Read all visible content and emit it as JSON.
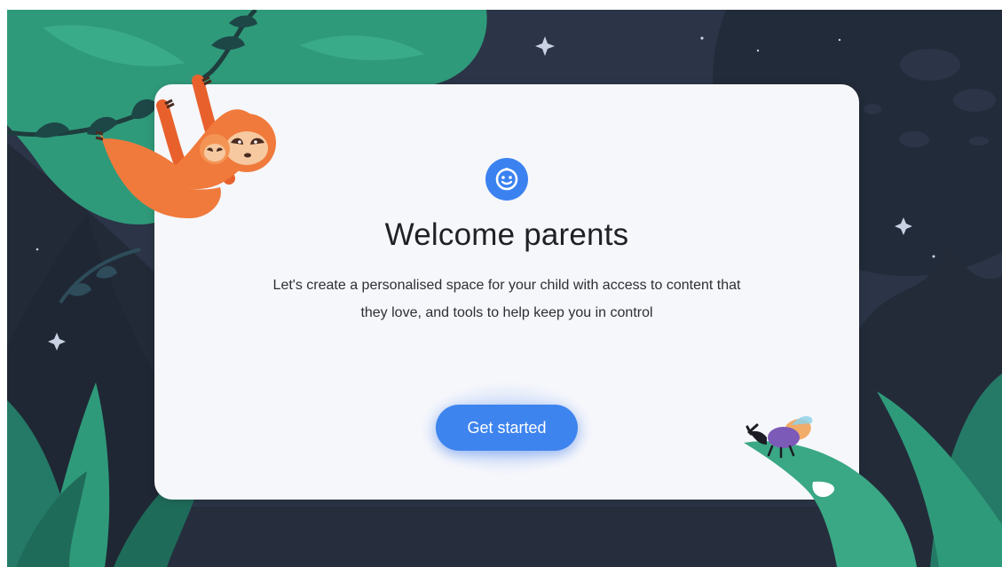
{
  "welcome": {
    "title": "Welcome parents",
    "description": "Let's create a personalised space for your child with access to content that they love, and tools to help keep you in control",
    "button_label": "Get started"
  },
  "icons": {
    "header": "smiley-face-icon"
  },
  "colors": {
    "accent": "#3e84ee",
    "background": "#2b3547",
    "card": "#f6f7fb",
    "foliage": "#2f9a7a",
    "sloth": "#f07a3c"
  }
}
